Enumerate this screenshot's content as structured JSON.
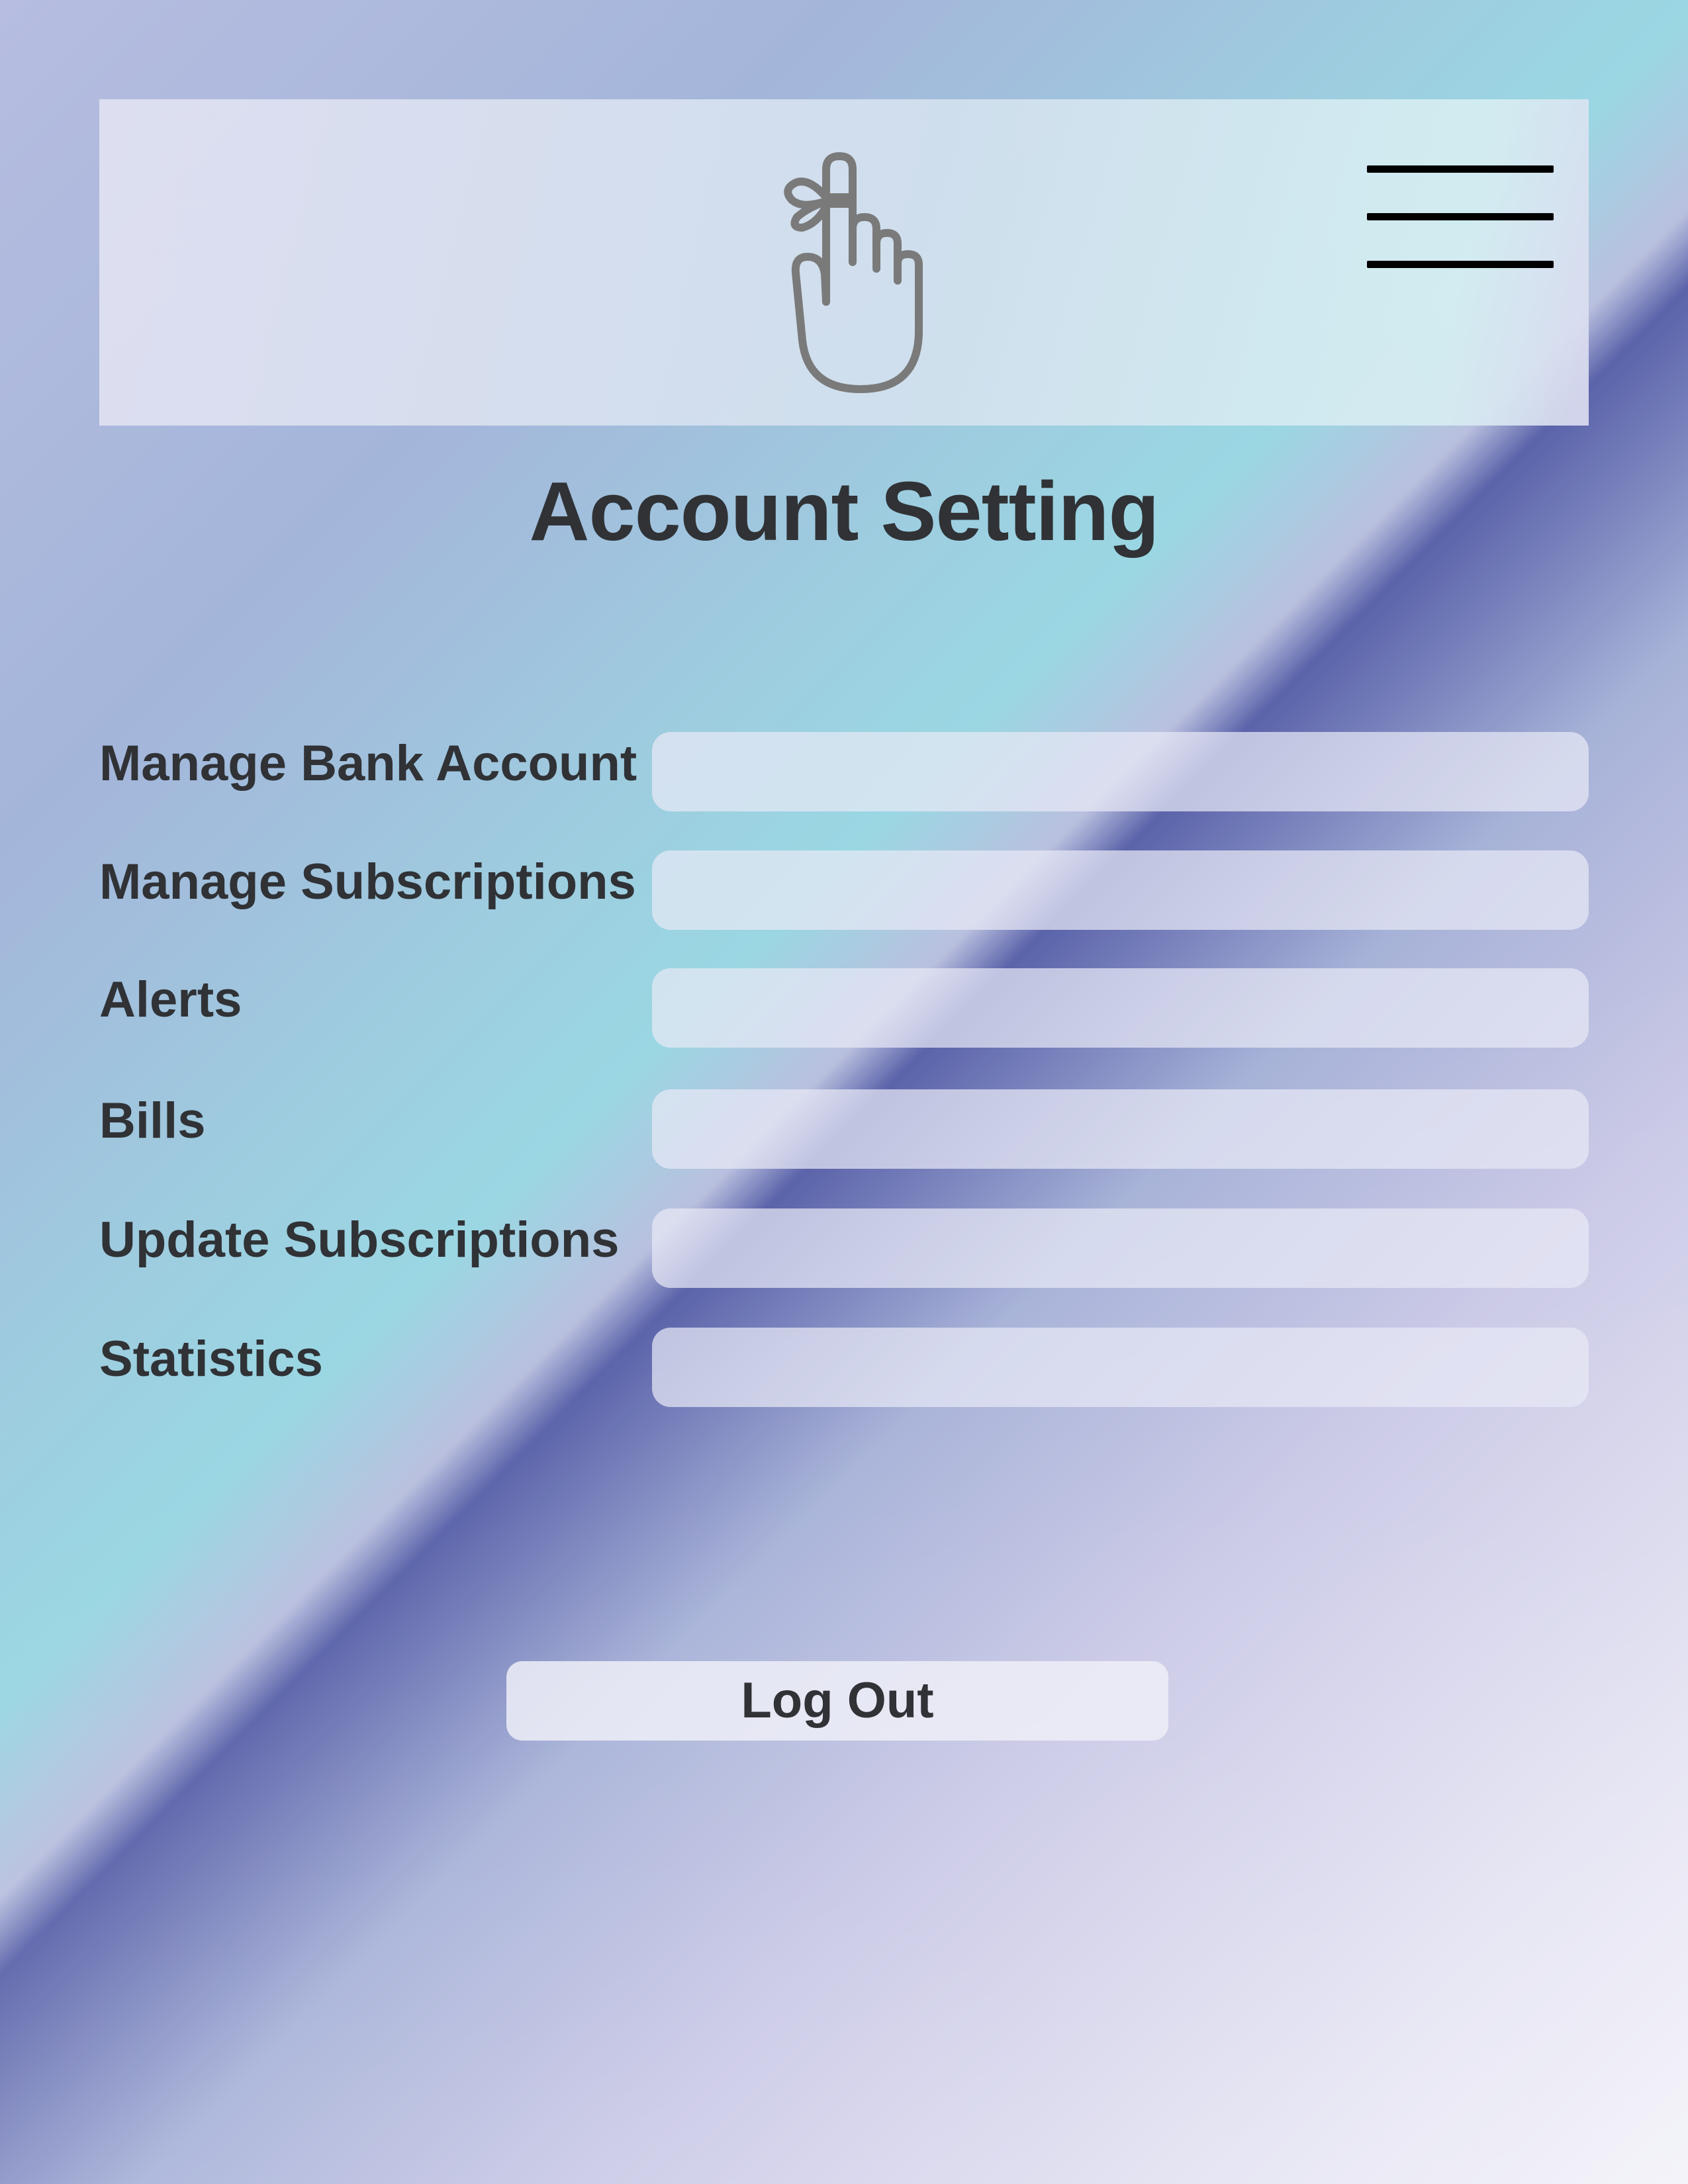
{
  "header": {
    "logo_icon": "finger-with-ribbon-icon",
    "menu_icon": "hamburger-menu-icon"
  },
  "page_title": "Account Setting",
  "settings": [
    {
      "label": "Manage Bank Account",
      "value": ""
    },
    {
      "label": "Manage Subscriptions",
      "value": ""
    },
    {
      "label": "Alerts",
      "value": ""
    },
    {
      "label": "Bills",
      "value": ""
    },
    {
      "label": "Update Subscriptions",
      "value": ""
    },
    {
      "label": "Statistics",
      "value": ""
    }
  ],
  "logout_label": "Log Out",
  "colors": {
    "text": "#303236",
    "field_background": "#e8e9f5",
    "header_background": "#d6e1ef",
    "icon_gray": "#7a7a7a"
  }
}
